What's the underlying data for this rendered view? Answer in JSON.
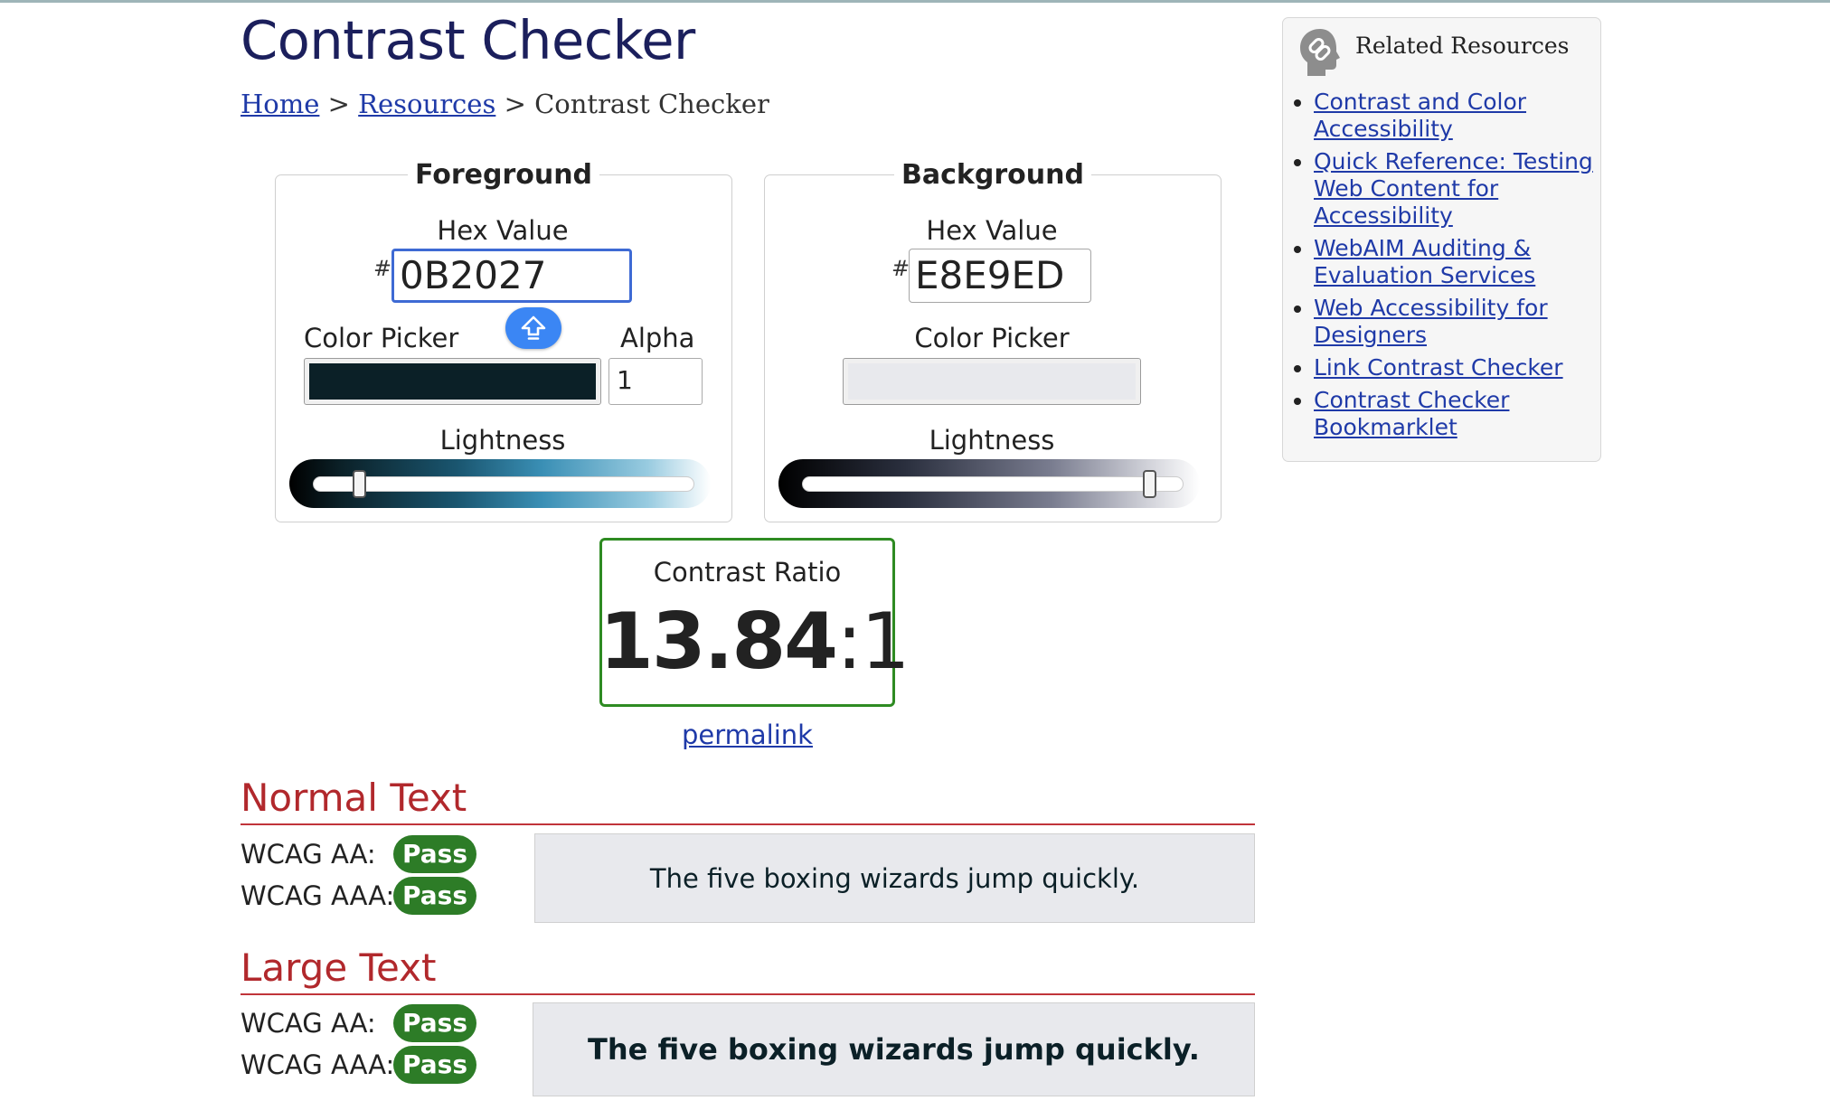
{
  "header": {
    "title": "Contrast Checker",
    "breadcrumb": {
      "home": "Home",
      "sep1": ">",
      "resources": "Resources",
      "sep2": ">",
      "current": "Contrast Checker"
    }
  },
  "foreground": {
    "legend": "Foreground",
    "hex_label": "Hex Value",
    "hash": "#",
    "hex_value": "0B2027",
    "picker_label": "Color Picker",
    "alpha_label": "Alpha",
    "alpha_value": "1",
    "lightness_label": "Lightness",
    "swatch_color": "#0b2027",
    "lightness_level": 0.12
  },
  "background": {
    "legend": "Background",
    "hex_label": "Hex Value",
    "hash": "#",
    "hex_value": "E8E9ED",
    "picker_label": "Color Picker",
    "lightness_label": "Lightness",
    "swatch_color": "#e8e9ed",
    "lightness_level": 0.91
  },
  "contrast": {
    "label": "Contrast Ratio",
    "ratio_main": "13.84",
    "ratio_suffix": ":1",
    "permalink": "permalink",
    "border_color": "#2e8b22"
  },
  "normal_text": {
    "title": "Normal Text",
    "aa_label": "WCAG AA:",
    "aa_result": "Pass",
    "aaa_label": "WCAG AAA:",
    "aaa_result": "Pass",
    "sample": "The five boxing wizards jump quickly."
  },
  "large_text": {
    "title": "Large Text",
    "aa_label": "WCAG AA:",
    "aa_result": "Pass",
    "aaa_label": "WCAG AAA:",
    "aaa_result": "Pass",
    "sample": "The five boxing wizards jump quickly."
  },
  "related": {
    "title": "Related Resources",
    "icon": "chain-link-head-icon",
    "links": [
      "Contrast and Color Accessibility",
      "Quick Reference: Testing Web Content for Accessibility",
      "WebAIM Auditing & Evaluation Services",
      "Web Accessibility for Designers",
      "Link Contrast Checker",
      "Contrast Checker Bookmarklet"
    ]
  },
  "colors": {
    "pass": "#2d7c27",
    "section_heading": "#b1282c",
    "link": "#1f3aa8",
    "keyboard_badge": "#3b86f4"
  }
}
